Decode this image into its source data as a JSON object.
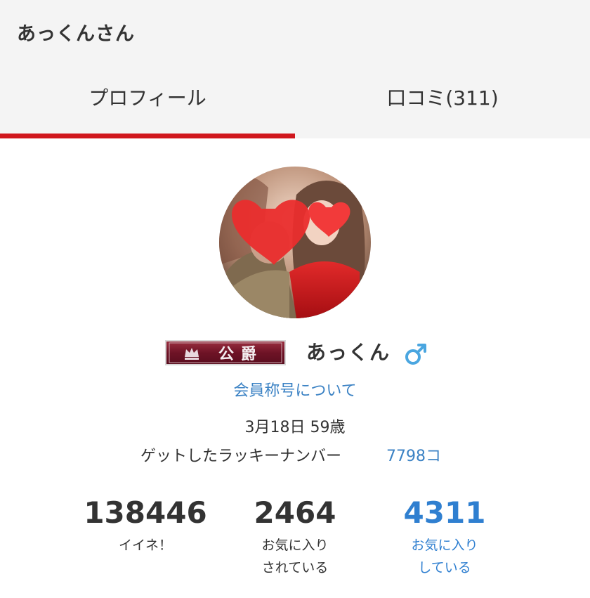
{
  "header": {
    "title": "あっくんさん"
  },
  "tabs": [
    {
      "label": "プロフィール",
      "active": true
    },
    {
      "label": "口コミ(311)",
      "active": false
    }
  ],
  "profile": {
    "title_badge": "公爵",
    "name": "あっくん",
    "gender_icon": "male-symbol-icon",
    "member_title_link": "会員称号について",
    "birth_age": "3月18日 59歳",
    "lucky_label": "ゲットしたラッキーナンバー",
    "lucky_value": "7798コ"
  },
  "stats": [
    {
      "value": "138446",
      "line1": "イイネ！",
      "line2": ""
    },
    {
      "value": "2464",
      "line1": "お気に入り",
      "line2": "されている"
    },
    {
      "value": "4311",
      "line1": "お気に入り",
      "line2": "している"
    }
  ],
  "colors": {
    "accent_red": "#d0171d",
    "link_blue": "#3b82c4",
    "header_bg": "#f4f4f4"
  }
}
